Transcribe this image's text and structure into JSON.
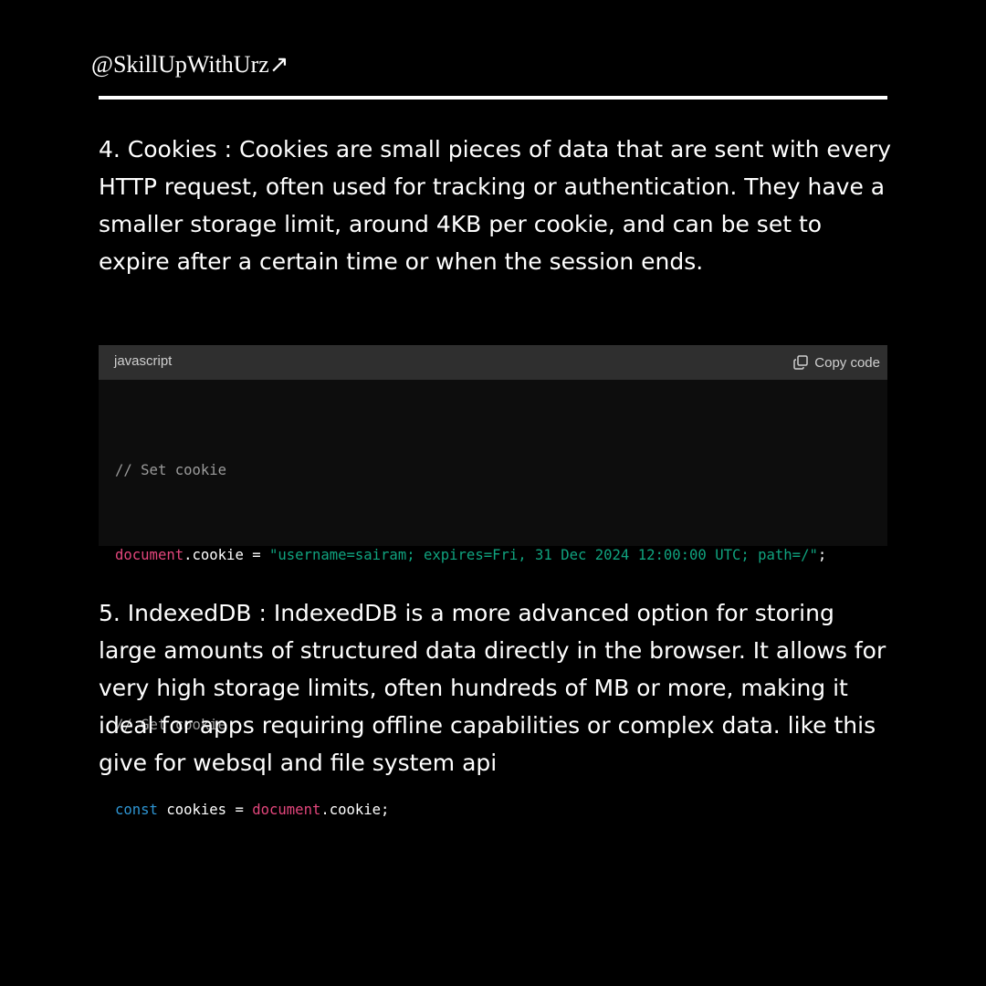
{
  "header": {
    "handle": "@SkillUpWithUrz↗"
  },
  "sections": {
    "cookies": "4. Cookies : Cookies are small pieces of data that are sent with every HTTP request, often used for tracking or authentication. They have a smaller storage limit, around 4KB per cookie, and can be set to expire after a certain time or when the session ends.",
    "indexeddb": "5. IndexedDB : IndexedDB is a more advanced option for storing large amounts of structured data directly in the browser. It allows for very high storage limits, often hundreds of MB or more, making it ideal for apps requiring offline capabilities or complex data. like this give for websql and file system api"
  },
  "code": {
    "language": "javascript",
    "copy_label": "Copy code",
    "copy_icon": "copy-icon",
    "line1": {
      "comment": "// Set cookie"
    },
    "line2": {
      "obj": "document",
      "prop": ".cookie = ",
      "str": "\"username=sairam; expires=Fri, 31 Dec 2024 12:00:00 UTC; path=/\"",
      "end": ";"
    },
    "line4": {
      "comment": "// Get cookie"
    },
    "line5": {
      "kw": "const",
      "mid": " cookies = ",
      "obj": "document",
      "end": ".cookie;"
    }
  },
  "colors": {
    "background": "#000000",
    "code_bg": "#0d0d0d",
    "code_header_bg": "#2f2f2f",
    "comment": "#9b9b9b",
    "object": "#e3467c",
    "string": "#10a37f",
    "keyword": "#2e95d3"
  }
}
